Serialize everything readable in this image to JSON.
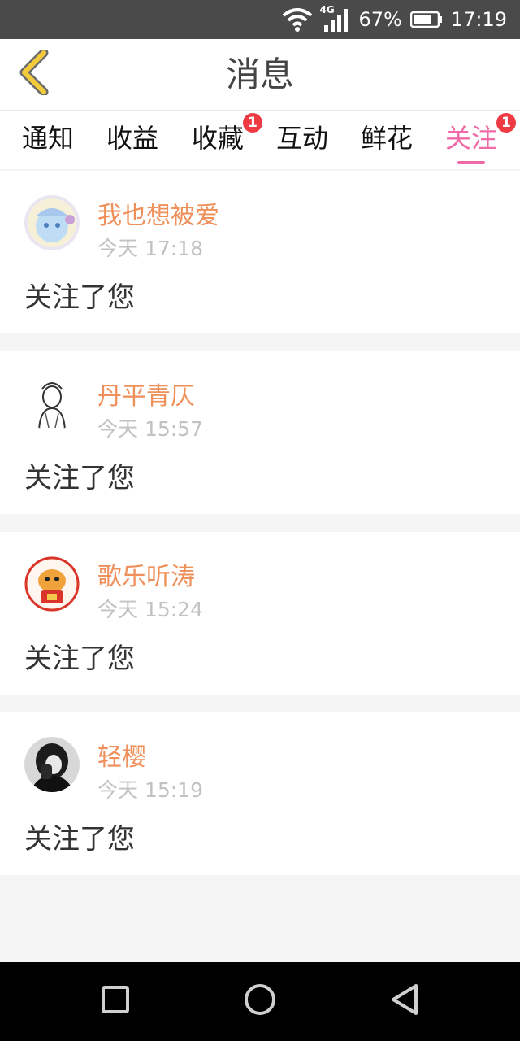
{
  "status_bar": {
    "network": "4G",
    "battery": "67%",
    "time": "17:19"
  },
  "header": {
    "title": "消息"
  },
  "tabs": [
    {
      "label": "通知",
      "badge": ""
    },
    {
      "label": "收益",
      "badge": ""
    },
    {
      "label": "收藏",
      "badge": "1"
    },
    {
      "label": "互动",
      "badge": ""
    },
    {
      "label": "鲜花",
      "badge": ""
    },
    {
      "label": "关注",
      "badge": "1",
      "active": true
    }
  ],
  "messages": [
    {
      "name": "我也想被爱",
      "time": "今天 17:18",
      "text": "关注了您"
    },
    {
      "name": "丹平青仄",
      "time": "今天 15:57",
      "text": "关注了您"
    },
    {
      "name": "歌乐听涛",
      "time": "今天 15:24",
      "text": "关注了您"
    },
    {
      "name": "轻樱",
      "time": "今天 15:19",
      "text": "关注了您"
    }
  ],
  "colors": {
    "accent_pink": "#f06aa8",
    "name_orange": "#ef8f5a",
    "badge_red": "#ee3b43",
    "back_yellow": "#f1cb3c"
  },
  "icons": {
    "back": "chevron-left-icon",
    "nav_recent": "square-icon",
    "nav_home": "circle-icon",
    "nav_back": "triangle-left-icon"
  }
}
